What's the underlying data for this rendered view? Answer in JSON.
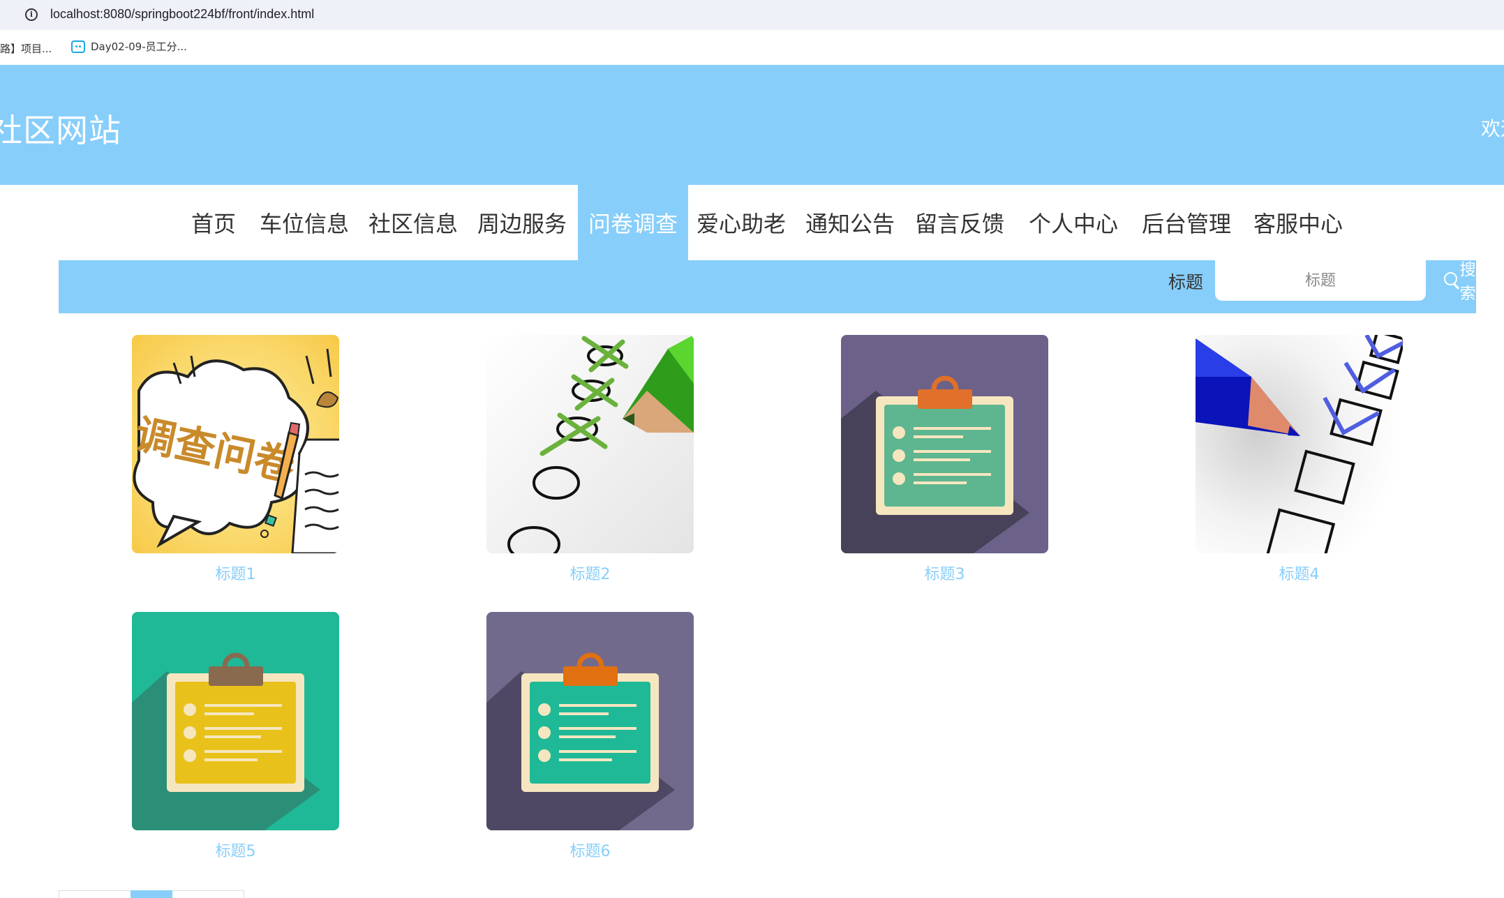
{
  "browser": {
    "url": "localhost:8080/springboot224bf/front/index.html",
    "bookmarks": [
      "路】项目...",
      "Day02-09-员工分..."
    ]
  },
  "header": {
    "site_title": "社区网站",
    "welcome": "欢迎"
  },
  "nav": {
    "items": [
      "首页",
      "车位信息",
      "社区信息",
      "周边服务",
      "问卷调查",
      "爱心助老",
      "通知公告",
      "留言反馈",
      "个人中心",
      "后台管理",
      "客服中心"
    ],
    "active": "问卷调查"
  },
  "search": {
    "label": "标题",
    "placeholder": "标题",
    "button_label": "搜索"
  },
  "cards": [
    {
      "title": "标题1",
      "image_text": "调查问卷"
    },
    {
      "title": "标题2"
    },
    {
      "title": "标题3"
    },
    {
      "title": "标题4"
    },
    {
      "title": "标题5"
    },
    {
      "title": "标题6"
    }
  ],
  "colors": {
    "theme": "#87cefa",
    "text": "#333333"
  }
}
